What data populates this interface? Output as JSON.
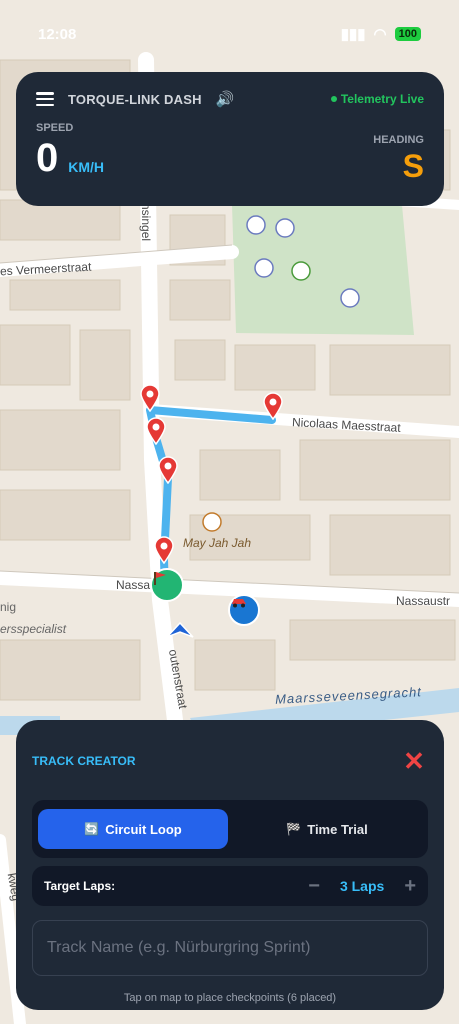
{
  "status_bar": {
    "time": "12:08",
    "battery": "100"
  },
  "hud": {
    "app_title": "TORQUE-LINK DASH",
    "telemetry_status": "Telemetry Live",
    "speed_label": "SPEED",
    "speed_value": "0",
    "speed_unit": "KM/H",
    "heading_label": "HEADING",
    "heading_value": "S"
  },
  "map": {
    "streets": {
      "vermeerstraat": "es Vermeerstraat",
      "singel": "Pieter Saenredamsingel",
      "maesstraat": "Nicolaas Maesstraat",
      "nassau_left": "Nassaus",
      "nassau_right": "Nassaustr",
      "routenstraat": "outenstraat",
      "kweg": "kweg",
      "nig": "nig",
      "specialist": "ersspecialist",
      "canal": "Maarsseveensegracht"
    },
    "poi_restaurant": "May Jah Jah"
  },
  "panel": {
    "title": "TRACK CREATOR",
    "modes": [
      {
        "label": "Circuit Loop",
        "icon": "loop-icon",
        "active": true
      },
      {
        "label": "Time Trial",
        "icon": "checkered-flag-icon",
        "active": false
      }
    ],
    "laps_label": "Target Laps:",
    "laps_value": "3 Laps",
    "track_name_placeholder": "Track Name (e.g. Nürburgring Sprint)",
    "hint": "Tap on map to place checkpoints (6 placed)"
  },
  "colors": {
    "panel_bg": "#1f2937",
    "accent_blue": "#38bdf8",
    "active_mode": "#2563eb",
    "telemetry_green": "#22c55e",
    "heading_orange": "#f59e0b",
    "close_red": "#ef4444",
    "route_blue": "#4db3ee"
  }
}
